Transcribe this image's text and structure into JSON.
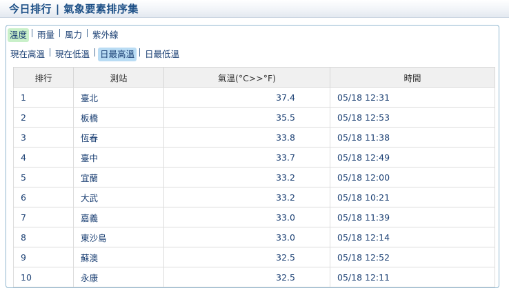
{
  "header": {
    "title": "今日排行 | 氣象要素排序集"
  },
  "tabs": [
    {
      "label": "溫度",
      "active": true
    },
    {
      "label": "雨量",
      "active": false
    },
    {
      "label": "風力",
      "active": false
    },
    {
      "label": "紫外線",
      "active": false
    }
  ],
  "subtabs": [
    {
      "label": "現在高溫",
      "active": false
    },
    {
      "label": "現在低溫",
      "active": false
    },
    {
      "label": "日最高溫",
      "active": true
    },
    {
      "label": "日最低溫",
      "active": false
    }
  ],
  "table": {
    "columns": [
      "排行",
      "測站",
      "氣溫(°C>>°F)",
      "時間"
    ],
    "rows": [
      {
        "rank": "1",
        "station": "臺北",
        "temp": "37.4",
        "time": "05/18 12:31"
      },
      {
        "rank": "2",
        "station": "板橋",
        "temp": "35.5",
        "time": "05/18 12:53"
      },
      {
        "rank": "3",
        "station": "恆春",
        "temp": "33.8",
        "time": "05/18 11:38"
      },
      {
        "rank": "4",
        "station": "臺中",
        "temp": "33.7",
        "time": "05/18 12:49"
      },
      {
        "rank": "5",
        "station": "宜蘭",
        "temp": "33.2",
        "time": "05/18 12:00"
      },
      {
        "rank": "6",
        "station": "大武",
        "temp": "33.2",
        "time": "05/18 10:21"
      },
      {
        "rank": "7",
        "station": "嘉義",
        "temp": "33.0",
        "time": "05/18 11:39"
      },
      {
        "rank": "8",
        "station": "東沙島",
        "temp": "33.0",
        "time": "05/18 12:14"
      },
      {
        "rank": "9",
        "station": "蘇澳",
        "temp": "32.5",
        "time": "05/18 12:52"
      },
      {
        "rank": "10",
        "station": "永康",
        "temp": "32.5",
        "time": "05/18 12:11"
      }
    ]
  },
  "colors": {
    "title": "#1c4f86",
    "text": "#1a3f73",
    "tab_active_bg": "#c9f0c9",
    "subtab_active_bg": "#b9dcf4",
    "panel_border": "#8fb6cf"
  }
}
